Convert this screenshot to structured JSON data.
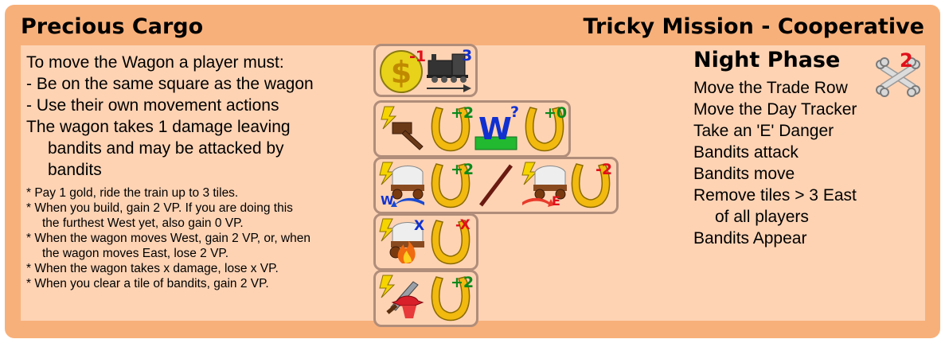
{
  "header": {
    "title": "Precious Cargo",
    "mission": "Tricky Mission - Cooperative"
  },
  "rules": {
    "main": [
      "To move the Wagon a player must:",
      "- Be on the same square as the wagon",
      "- Use their own movement actions",
      "The wagon takes 1 damage leaving",
      "bandits and may be attacked by",
      "bandits"
    ],
    "notes": [
      "* Pay 1 gold, ride the train up to 3 tiles.",
      "* When you build, gain 2 VP. If you are doing this",
      "the furthest West yet, also gain 0 VP.",
      "* When the wagon moves West, gain 2 VP, or, when",
      "the wagon moves East, lose 2 VP.",
      "* When the wagon takes x damage, lose x VP.",
      "* When you clear a tile of bandits, gain 2 VP."
    ]
  },
  "actions": {
    "train": {
      "gold_cost": "-1",
      "train_range": "3"
    },
    "build": {
      "vp_gain": "+2",
      "west_letter": "W",
      "west_query": "?",
      "west_vp": "+0"
    },
    "wagon_move": {
      "west_label": "W",
      "west_vp": "+2",
      "east_label": "E",
      "east_vp": "-2"
    },
    "damage": {
      "damage_label": "X",
      "vp_loss": "-X"
    },
    "clear": {
      "vp_gain": "+2"
    }
  },
  "night_phase": {
    "title": "Night Phase",
    "danger_count": "2",
    "steps": [
      "Move the Trade Row",
      "Move the Day Tracker",
      "Take an 'E' Danger",
      "Bandits attack",
      "Bandits move",
      "Remove tiles > 3 East",
      "of all players",
      "Bandits Appear"
    ]
  },
  "colors": {
    "card_bg": "#f8b07a",
    "panel_bg": "#fdd3b4",
    "tile_border": "#b08d7a",
    "horseshoe": "#f2b90f",
    "lightning": "#f5d400",
    "vp_positive": "#0a8a1a",
    "vp_negative": "#e0101a"
  }
}
